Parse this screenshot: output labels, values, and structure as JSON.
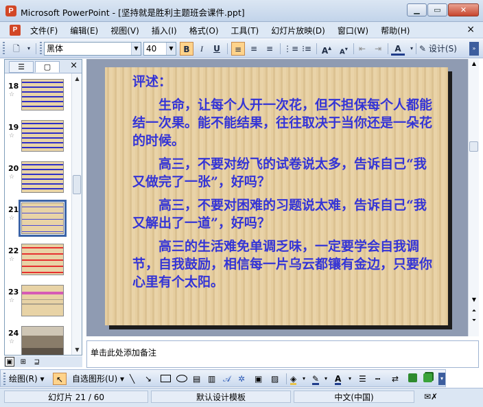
{
  "window": {
    "title": "Microsoft PowerPoint - [坚持就是胜利主题班会课件.ppt]",
    "app_icon": "P",
    "buttons": [
      "minimize-icon",
      "restore-icon",
      "close-icon"
    ]
  },
  "menubar": {
    "items": [
      "文件(F)",
      "编辑(E)",
      "视图(V)",
      "插入(I)",
      "格式(O)",
      "工具(T)",
      "幻灯片放映(D)",
      "窗口(W)",
      "帮助(H)"
    ],
    "close": "×"
  },
  "toolbar": {
    "font_name": "黑体",
    "font_size": "40",
    "bold": "B",
    "italic": "I",
    "underline": "U",
    "design_label": "设计(S)"
  },
  "left_pane": {
    "tab_outline_icon": "outline-icon",
    "tab_slides_icon": "slides-icon",
    "close": "×",
    "slides": [
      {
        "num": "18",
        "style": "blue-lines"
      },
      {
        "num": "19",
        "style": "blue-lines"
      },
      {
        "num": "20",
        "style": "blue-lines"
      },
      {
        "num": "21",
        "style": "current"
      },
      {
        "num": "22",
        "style": "red-lines"
      },
      {
        "num": "23",
        "style": "title-pink"
      },
      {
        "num": "24",
        "style": "photo"
      }
    ]
  },
  "slide": {
    "heading": "评述：",
    "paragraphs": [
      "生命，让每个人开一次花，但不担保每个人都能结一次果。能不能结果，往往取决于当你还是一朵花的时候。",
      "高三，不要对纷飞的试卷说太多，告诉自己“我又做完了一张”，好吗？",
      "高三，不要对困难的习题说太难，告诉自己“我又解出了一道”，好吗？",
      "高三的生活难免单调乏味，一定要学会自我调节，自我鼓励，相信每一片乌云都镶有金边，只要你心里有个太阳。"
    ]
  },
  "notes": {
    "placeholder": "单击此处添加备注"
  },
  "drawbar": {
    "draw_label": "绘图(R)",
    "autoshapes_label": "自选图形(U)"
  },
  "statusbar": {
    "slide_info": "幻灯片 21 / 60",
    "template": "默认设计模板",
    "language": "中文(中国)"
  },
  "colors": {
    "slide_text": "#3434d6",
    "slide_bg": "#e6cea0",
    "selected_outline": "#3c64a8"
  }
}
